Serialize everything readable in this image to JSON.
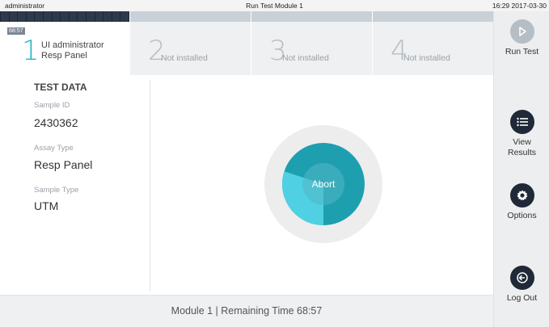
{
  "statusbar": {
    "user": "administrator",
    "title": "Run Test Module 1",
    "clock": "16:29 2017-03-30"
  },
  "modules": [
    {
      "number": "1",
      "timer": "68:57",
      "line1": "UI administrator",
      "line2": "Resp Panel",
      "active": true
    },
    {
      "number": "2",
      "status": "Not installed"
    },
    {
      "number": "3",
      "status": "Not installed"
    },
    {
      "number": "4",
      "status": "Not installed"
    }
  ],
  "test_data": {
    "heading": "TEST DATA",
    "sample_id_label": "Sample ID",
    "sample_id": "2430362",
    "assay_type_label": "Assay Type",
    "assay_type": "Resp Panel",
    "sample_type_label": "Sample Type",
    "sample_type": "UTM"
  },
  "progress": {
    "abort_label": "Abort",
    "fraction_complete": 0.3,
    "colors": {
      "ring": "#ececec",
      "inner": "#1e9fb0",
      "wedge": "#4fd0e3"
    }
  },
  "rail": {
    "run_test": "Run Test",
    "view_results_1": "View",
    "view_results_2": "Results",
    "options": "Options",
    "log_out": "Log Out"
  },
  "footer": {
    "text": "Module 1  |  Remaining Time  68:57"
  },
  "colors": {
    "accent": "#24b4c9",
    "dark": "#1f2937"
  }
}
